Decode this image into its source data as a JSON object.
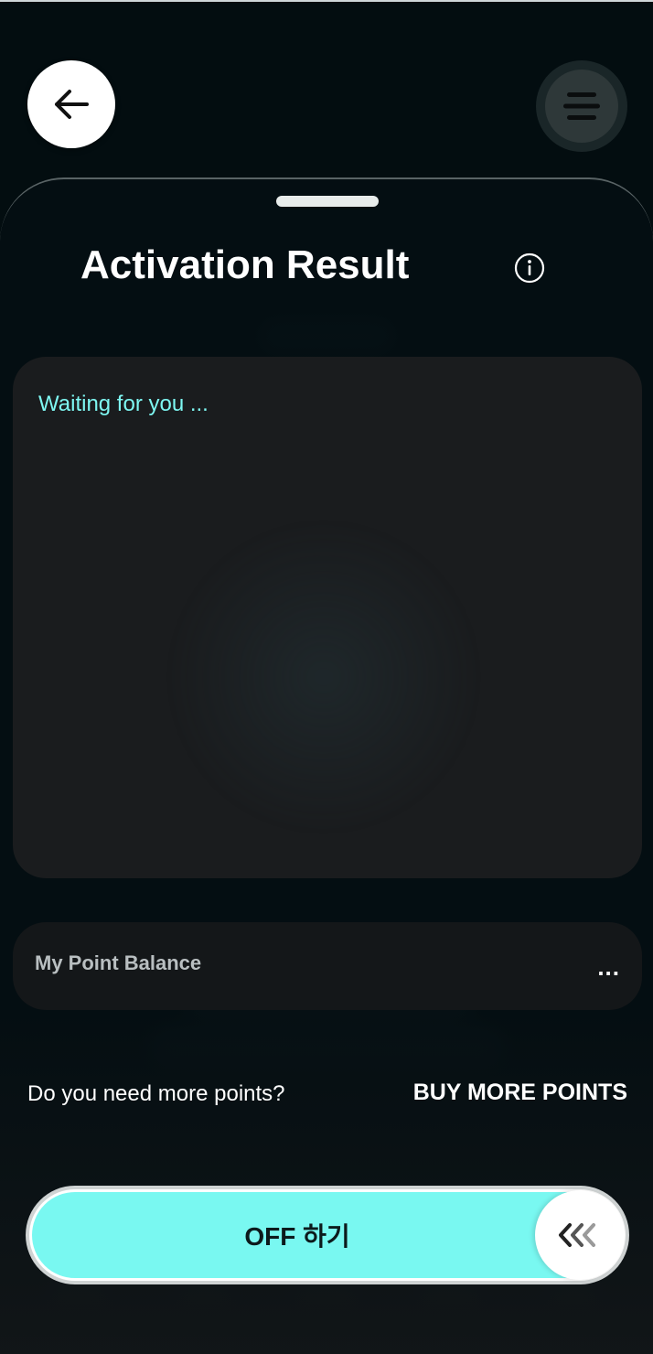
{
  "header": {
    "back_icon": "arrow-left-icon",
    "menu_icon": "hamburger-menu-icon"
  },
  "sheet": {
    "title": "Activation Result",
    "info_icon": "info-icon"
  },
  "activation": {
    "status_text": "Waiting for you ..."
  },
  "points": {
    "label": "My Point Balance",
    "value": "..."
  },
  "purchase": {
    "prompt": "Do you need more points?",
    "link_label": "BUY MORE POINTS"
  },
  "slider": {
    "label": "OFF 하기",
    "knob_icon": "triple-chevron-left-icon"
  },
  "colors": {
    "accent": "#79f8f1",
    "status_text": "#7ef7f2",
    "background": "#030d10"
  }
}
